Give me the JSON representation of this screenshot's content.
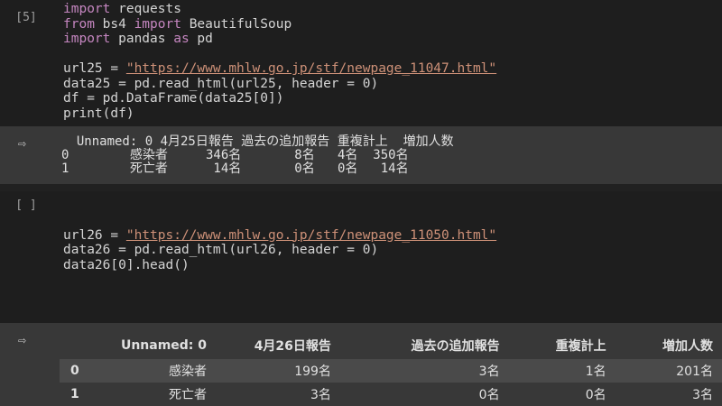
{
  "cell1": {
    "exec_count": "[5]",
    "lines": [
      {
        "parts": [
          {
            "t": "import",
            "k": "kw"
          },
          {
            "t": " requests",
            "k": ""
          }
        ]
      },
      {
        "parts": [
          {
            "t": "from",
            "k": "kw"
          },
          {
            "t": " bs4 ",
            "k": ""
          },
          {
            "t": "import",
            "k": "kw"
          },
          {
            "t": " BeautifulSoup",
            "k": ""
          }
        ]
      },
      {
        "parts": [
          {
            "t": "import",
            "k": "kw"
          },
          {
            "t": " pandas ",
            "k": ""
          },
          {
            "t": "as",
            "k": "kw"
          },
          {
            "t": " pd",
            "k": ""
          }
        ]
      },
      {
        "parts": [
          {
            "t": "",
            "k": ""
          }
        ]
      },
      {
        "parts": [
          {
            "t": "url25 = ",
            "k": ""
          },
          {
            "t": "\"https://www.mhlw.go.jp/stf/newpage_11047.html\"",
            "k": "str"
          }
        ]
      },
      {
        "parts": [
          {
            "t": "data25 = pd.read_html(url25, header = 0)",
            "k": ""
          }
        ]
      },
      {
        "parts": [
          {
            "t": "df = pd.DataFrame(data25[0])",
            "k": ""
          }
        ]
      },
      {
        "parts": [
          {
            "t": "print(df)",
            "k": ""
          }
        ]
      }
    ],
    "output": "  Unnamed: 0 4月25日報告 過去の追加報告 重複計上  増加人数\n0        感染者     346名       8名   4名  350名\n1        死亡者      14名       0名   0名   14名"
  },
  "cell2": {
    "exec_count": "[ ]",
    "lines": [
      {
        "parts": [
          {
            "t": "",
            "k": ""
          }
        ]
      },
      {
        "parts": [
          {
            "t": "url26 = ",
            "k": ""
          },
          {
            "t": "\"https://www.mhlw.go.jp/stf/newpage_11050.html\"",
            "k": "str"
          }
        ]
      },
      {
        "parts": [
          {
            "t": "data26 = pd.read_html(url26, header = 0)",
            "k": ""
          }
        ]
      },
      {
        "parts": [
          {
            "t": "data26[0].head()",
            "k": ""
          }
        ]
      }
    ],
    "table": {
      "headers": [
        "",
        "Unnamed: 0",
        "4月26日報告",
        "過去の追加報告",
        "重複計上",
        "増加人数"
      ],
      "rows": [
        [
          "0",
          "感染者",
          "199名",
          "3名",
          "1名",
          "201名"
        ],
        [
          "1",
          "死亡者",
          "3名",
          "0名",
          "0名",
          "3名"
        ]
      ]
    }
  },
  "icons": {
    "output": "output-icon"
  }
}
